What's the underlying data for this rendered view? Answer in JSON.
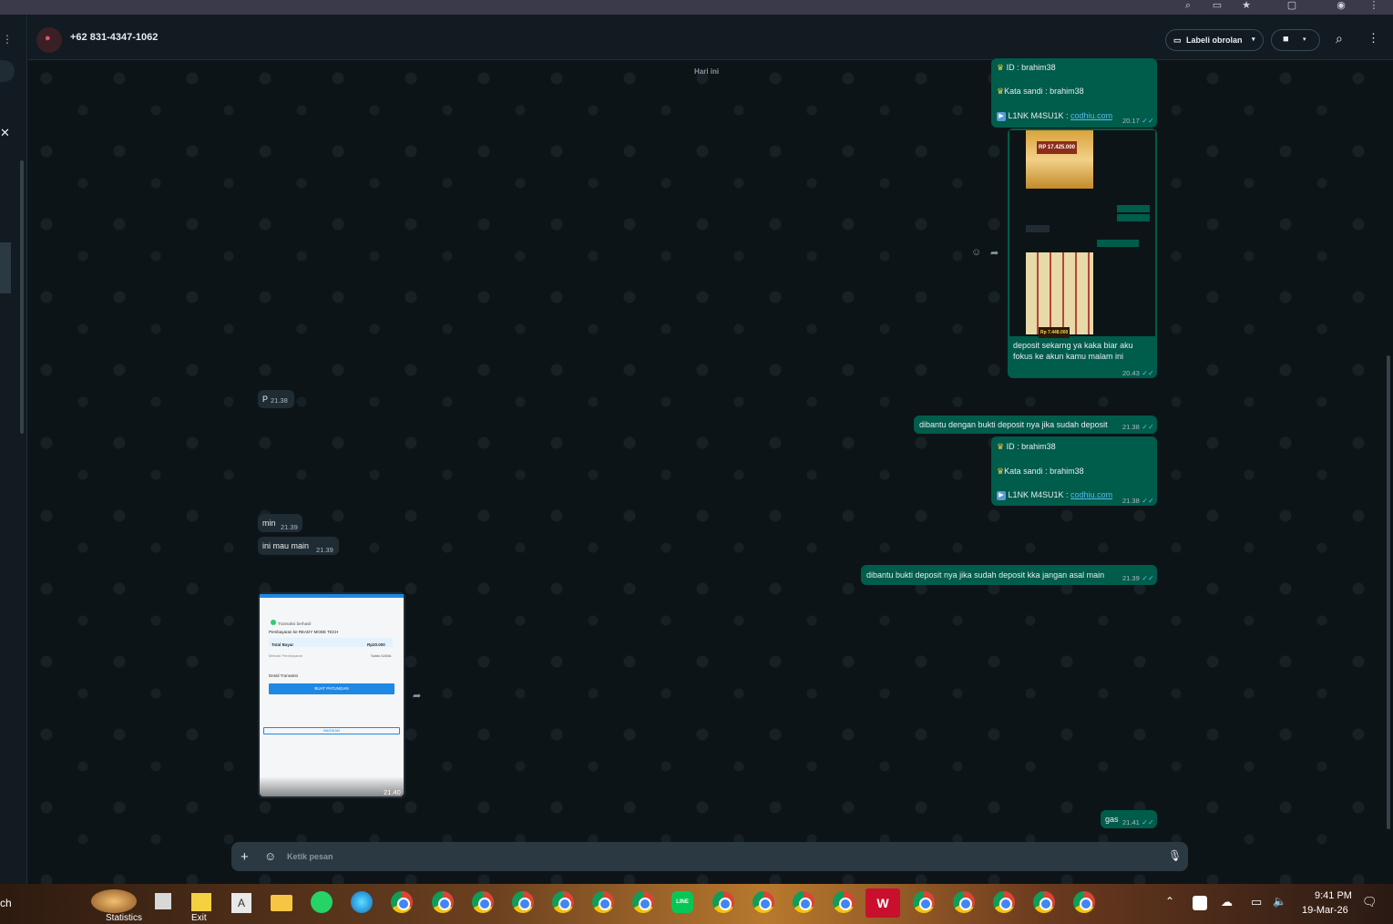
{
  "chat": {
    "contact_name": "+62 831-4347-1062",
    "label_button": "Labeli obrolan",
    "date_chip": "Hari ini"
  },
  "messages": {
    "m1": {
      "id_line": "ID :  brahim38",
      "pass_line": "Kata sandi : brahim38",
      "link_prefix": "L1NK M4SU1K : ",
      "link": "codhiu.com",
      "time": "20.17"
    },
    "m2": {
      "caption_1": "deposit sekarng ya kaka biar aku",
      "caption_2": "fokus ke akun kamu malam ini",
      "time": "20.43",
      "thumb_text_1": "RP 17.425.000",
      "thumb_text_2": "Rp 7.448.000"
    },
    "m3": {
      "text": "P",
      "time": "21.38"
    },
    "m4": {
      "text": "dibantu dengan bukti deposit nya jika sudah deposit",
      "time": "21.38"
    },
    "m5": {
      "id_line": "ID :  brahim38",
      "pass_line": "Kata sandi : brahim38",
      "link_prefix": "L1NK M4SU1K : ",
      "link": "codhiu.com",
      "time": "21.38"
    },
    "m6": {
      "text": "min",
      "time": "21.39"
    },
    "m7": {
      "text": "ini mau main",
      "time": "21.39"
    },
    "m8": {
      "text": "dibantu bukti deposit nya jika sudah deposit kka jangan asal main",
      "time": "21.39"
    },
    "m9": {
      "time": "21.40",
      "receipt_status": "Transaksi berhasil",
      "receipt_title": "Pembayaran ke READY MODE TECH",
      "receipt_total_label": "Total Bayar",
      "receipt_total": "Rp20.000",
      "receipt_method": "Metode Pembayaran",
      "receipt_method_val": "Saldo DANA",
      "receipt_detail": "Detail Transaksi",
      "receipt_button": "BUAT PATUNGAN",
      "receipt_button2": "BAGIKAN"
    },
    "m10": {
      "text": "gas",
      "time": "21.41"
    }
  },
  "composer": {
    "placeholder": "Ketik pesan"
  },
  "taskbar": {
    "time": "9:41 PM",
    "date": "19-Mar-26",
    "left_text": "ch",
    "statistics_label": "Statistics",
    "exit_label": "Exit"
  },
  "colors": {
    "outgoing": "#005c4b",
    "incoming": "#202c33",
    "tick": "#53bdeb",
    "background": "#0b141a"
  }
}
